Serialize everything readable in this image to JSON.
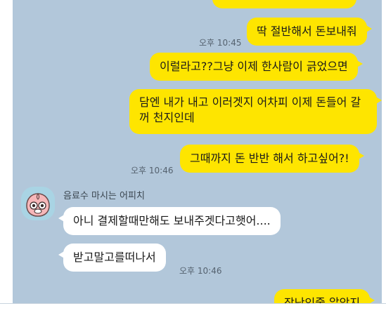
{
  "messages": {
    "m0_text": "",
    "m1_text": "딱 절반해서 돈보내줘",
    "m1_time": "오후 10:45",
    "m2_text": "이럴라고??그냥 이제 한사람이 긁었으면",
    "m3_text": "담엔 내가 내고 이러겟지 어차피 이제 돈들어 갈꺼 천지인데",
    "m4_text": "그때까지 돈 반반 해서 하고싶어?!",
    "m4_time": "오후 10:46",
    "sender_name": "음료수 마시는 어피치",
    "m5_text": "아니 결제할때만해도 보내주겟다고햇어....",
    "m6_text": "받고말고를떠나서",
    "m6_time": "오후 10:46",
    "m7_text": "장난인줄 알았지"
  },
  "colors": {
    "chat_bg": "#b2c7da",
    "outgoing_bubble": "#fee500",
    "incoming_bubble": "#ffffff"
  },
  "icons": {
    "avatar": "apeach-avatar-icon"
  }
}
